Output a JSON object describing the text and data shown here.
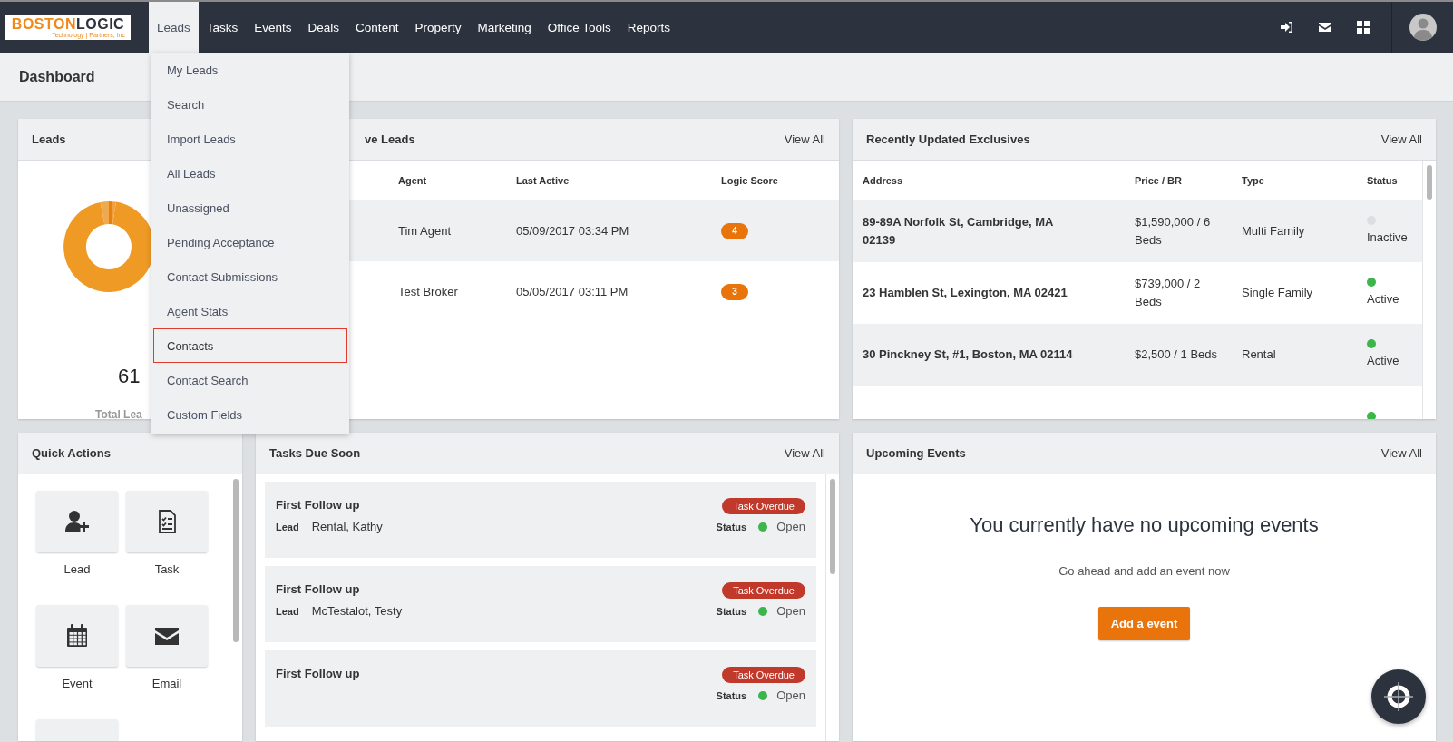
{
  "logo": {
    "part_1": "BOSTON",
    "part_2": "LOGIC",
    "tagline": "Technology | Partners, Inc"
  },
  "nav": [
    {
      "label": "Leads",
      "selected": true
    },
    {
      "label": "Tasks",
      "selected": false
    },
    {
      "label": "Events",
      "selected": false
    },
    {
      "label": "Deals",
      "selected": false
    },
    {
      "label": "Content",
      "selected": false
    },
    {
      "label": "Property",
      "selected": false
    },
    {
      "label": "Marketing",
      "selected": false
    },
    {
      "label": "Office Tools",
      "selected": false
    },
    {
      "label": "Reports",
      "selected": false
    }
  ],
  "page_title": "Dashboard",
  "leads_menu": [
    {
      "label": "My Leads",
      "focused": false
    },
    {
      "label": "Search",
      "focused": false
    },
    {
      "label": "Import Leads",
      "focused": false
    },
    {
      "label": "All Leads",
      "focused": false
    },
    {
      "label": "Unassigned",
      "focused": false
    },
    {
      "label": "Pending Acceptance",
      "focused": false
    },
    {
      "label": "Contact Submissions",
      "focused": false
    },
    {
      "label": "Agent Stats",
      "focused": false
    },
    {
      "label": "Contacts",
      "focused": true
    },
    {
      "label": "Contact Search",
      "focused": false
    },
    {
      "label": "Custom Fields",
      "focused": false
    }
  ],
  "leads_card": {
    "title": "Leads",
    "total": "61",
    "total_label": "Total Lea"
  },
  "active_leads": {
    "title": "ve Leads",
    "view_all": "View All",
    "columns": [
      "Agent",
      "Last Active",
      "Logic Score"
    ],
    "rows": [
      {
        "agent": "Tim Agent",
        "last_active": "05/09/2017 03:34 PM",
        "score": "4"
      },
      {
        "agent": "Test Broker",
        "last_active": "05/05/2017 03:11 PM",
        "score": "3"
      }
    ]
  },
  "exclusives": {
    "title": "Recently Updated Exclusives",
    "view_all": "View All",
    "columns": [
      "Address",
      "Price / BR",
      "Type",
      "Status"
    ],
    "rows": [
      {
        "address": "89-89A Norfolk St, Cambridge, MA 02139",
        "price": "$1,590,000 / 6 Beds",
        "type": "Multi Family",
        "status": "Inactive",
        "color": "#dcdee1"
      },
      {
        "address": "23 Hamblen St, Lexington, MA 02421",
        "price": "$739,000 / 2 Beds",
        "type": "Single Family",
        "status": "Active",
        "color": "#3cb54a"
      },
      {
        "address": "30 Pinckney St, #1, Boston, MA 02114",
        "price": "$2,500 / 1 Beds",
        "type": "Rental",
        "status": "Active",
        "color": "#3cb54a"
      },
      {
        "color": "#3cb54a"
      }
    ]
  },
  "quick_actions": {
    "title": "Quick Actions",
    "actions": [
      {
        "kind": "lead",
        "label": "Lead"
      },
      {
        "kind": "task",
        "label": "Task"
      },
      {
        "kind": "event",
        "label": "Event"
      },
      {
        "kind": "email",
        "label": "Email"
      },
      {
        "kind": "more"
      }
    ]
  },
  "tasks": {
    "title": "Tasks Due Soon",
    "view_all": "View All",
    "items": [
      {
        "title": "First Follow up",
        "badge": "Task Overdue",
        "lead_label": "Lead",
        "lead": "Rental, Kathy",
        "status_label": "Status",
        "status": "Open"
      },
      {
        "title": "First Follow up",
        "badge": "Task Overdue",
        "lead_label": "Lead",
        "lead": "McTestalot, Testy",
        "status_label": "Status",
        "status": "Open"
      },
      {
        "title": "First Follow up",
        "badge": "Task Overdue",
        "status_label": "Status",
        "status": "Open"
      }
    ]
  },
  "events": {
    "title": "Upcoming Events",
    "view_all": "View All",
    "message": "You currently have no upcoming events",
    "hint": "Go ahead and add an event now",
    "button": "Add a event"
  }
}
